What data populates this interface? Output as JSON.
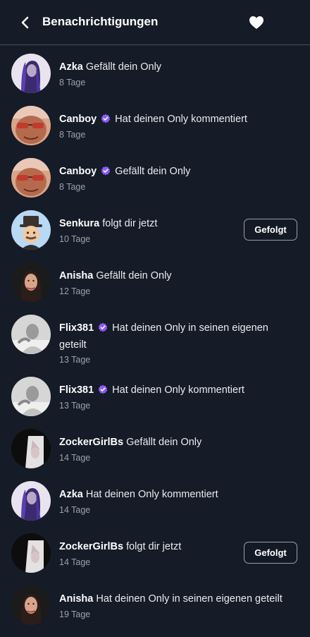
{
  "header": {
    "title": "Benachrichtigungen",
    "back_icon": "chevron-left-icon",
    "favorite_icon": "heart-icon"
  },
  "colors": {
    "background": "#151b27",
    "verified_badge": "#8a5cf6",
    "secondary_text": "#9ba1ac"
  },
  "notifications": [
    {
      "user": "Azka",
      "verified": false,
      "action": "Gefällt dein Only",
      "time": "8 Tage",
      "avatar": "azka-avatar"
    },
    {
      "user": "Canboy",
      "verified": true,
      "action": "Hat deinen Only kommentiert",
      "time": "8 Tage",
      "avatar": "canboy-avatar"
    },
    {
      "user": "Canboy",
      "verified": true,
      "action": "Gefällt dein Only",
      "time": "8 Tage",
      "avatar": "canboy-avatar"
    },
    {
      "user": "Senkura",
      "verified": false,
      "action": "folgt dir jetzt",
      "time": "10 Tage",
      "avatar": "senkura-avatar",
      "button": "Gefolgt"
    },
    {
      "user": "Anisha",
      "verified": false,
      "action": "Gefällt dein Only",
      "time": "12 Tage",
      "avatar": "anisha-avatar"
    },
    {
      "user": "Flix381",
      "verified": true,
      "action": "Hat deinen Only in seinen eigenen",
      "action_line2": "geteilt",
      "time": "13 Tage",
      "avatar": "flix-avatar"
    },
    {
      "user": "Flix381",
      "verified": true,
      "action": "Hat deinen Only kommentiert",
      "time": "13 Tage",
      "avatar": "flix-avatar"
    },
    {
      "user": "ZockerGirlBs",
      "verified": false,
      "action": "Gefällt dein Only",
      "time": "14 Tage",
      "avatar": "zocker-avatar"
    },
    {
      "user": "Azka",
      "verified": false,
      "action": "Hat deinen Only kommentiert",
      "time": "14 Tage",
      "avatar": "azka-avatar"
    },
    {
      "user": "ZockerGirlBs",
      "verified": false,
      "action": "folgt dir jetzt",
      "time": "14 Tage",
      "avatar": "zocker-avatar",
      "button": "Gefolgt"
    },
    {
      "user": "Anisha",
      "verified": false,
      "action": "Hat deinen Only in seinen eigenen geteilt",
      "time": "19 Tage",
      "avatar": "anisha-avatar"
    }
  ]
}
